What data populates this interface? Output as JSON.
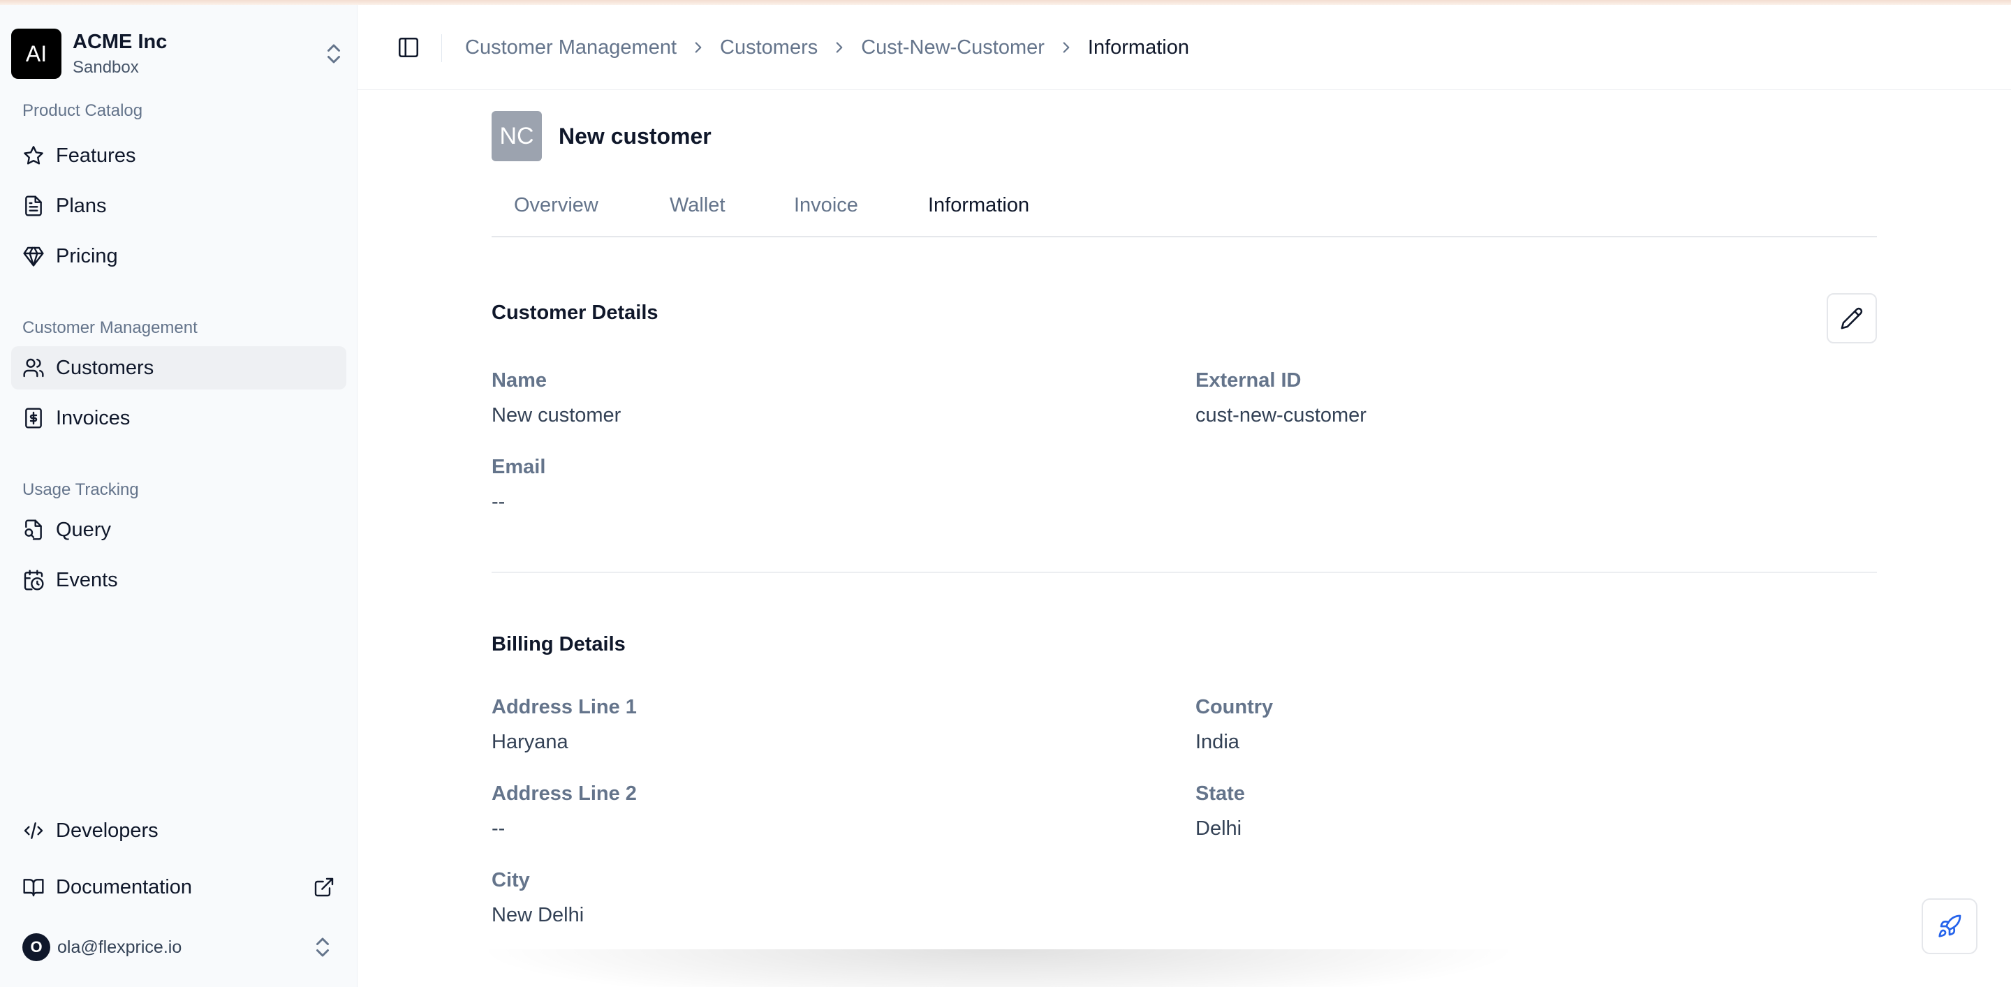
{
  "org": {
    "avatar_text": "AI",
    "name": "ACME Inc",
    "environment": "Sandbox"
  },
  "sidebar": {
    "sections": [
      {
        "label": "Product Catalog"
      },
      {
        "label": "Customer Management"
      },
      {
        "label": "Usage Tracking"
      }
    ],
    "items": [
      {
        "label": "Features",
        "icon": "star-icon"
      },
      {
        "label": "Plans",
        "icon": "file-text-icon"
      },
      {
        "label": "Pricing",
        "icon": "gem-icon"
      },
      {
        "label": "Customers",
        "icon": "users-icon",
        "active": true
      },
      {
        "label": "Invoices",
        "icon": "receipt-icon"
      },
      {
        "label": "Query",
        "icon": "file-search-icon"
      },
      {
        "label": "Events",
        "icon": "calendar-clock-icon"
      }
    ],
    "footer": [
      {
        "label": "Developers",
        "icon": "code-icon"
      },
      {
        "label": "Documentation",
        "icon": "book-open-icon",
        "external_icon": "external-link-icon"
      }
    ],
    "user": {
      "avatar_text": "O",
      "email": "ola@flexprice.io"
    }
  },
  "breadcrumb": [
    "Customer Management",
    "Customers",
    "Cust-New-Customer",
    "Information"
  ],
  "customer": {
    "avatar_text": "NC",
    "name": "New customer"
  },
  "tabs": [
    {
      "label": "Overview"
    },
    {
      "label": "Wallet"
    },
    {
      "label": "Invoice"
    },
    {
      "label": "Information",
      "active": true
    }
  ],
  "customer_details": {
    "title": "Customer Details",
    "name_label": "Name",
    "name_value": "New customer",
    "external_id_label": "External ID",
    "external_id_value": "cust-new-customer",
    "email_label": "Email",
    "email_value": "--"
  },
  "billing_details": {
    "title": "Billing Details",
    "address1_label": "Address Line 1",
    "address1_value": "Haryana",
    "country_label": "Country",
    "country_value": "India",
    "address2_label": "Address Line 2",
    "address2_value": "--",
    "state_label": "State",
    "state_value": "Delhi",
    "city_label": "City",
    "city_value": "New Delhi"
  },
  "colors": {
    "accent": "#2563eb",
    "sidebar_bg": "#f8fafc",
    "active_item_bg": "#eef0f3"
  }
}
